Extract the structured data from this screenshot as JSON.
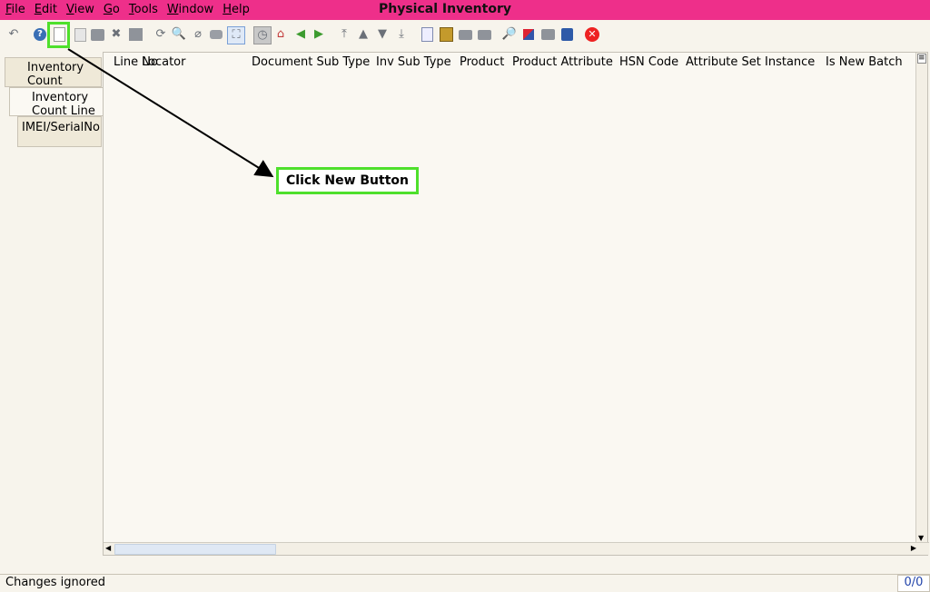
{
  "window": {
    "title": "Physical Inventory"
  },
  "menu": [
    {
      "pre": "",
      "u": "F",
      "post": "ile"
    },
    {
      "pre": "",
      "u": "E",
      "post": "dit"
    },
    {
      "pre": "",
      "u": "V",
      "post": "iew"
    },
    {
      "pre": "",
      "u": "G",
      "post": "o"
    },
    {
      "pre": "",
      "u": "T",
      "post": "ools"
    },
    {
      "pre": "",
      "u": "W",
      "post": "indow"
    },
    {
      "pre": "",
      "u": "H",
      "post": "elp"
    }
  ],
  "toolbar": {
    "icons": [
      "undo-icon",
      "help-icon",
      "new-record-icon",
      "copy-record-icon",
      "delete-icon",
      "delete-selection-icon",
      "save-icon",
      "refresh-icon",
      "find-icon",
      "attachment-icon",
      "chat-icon",
      "toggle-grid-icon",
      "history-icon",
      "home-icon",
      "back-icon",
      "forward-icon",
      "first-record-icon",
      "previous-record-icon",
      "next-record-icon",
      "last-record-icon",
      "report-icon",
      "archive-icon",
      "print-icon",
      "print-preview-icon",
      "zoom-across-icon",
      "active-workflows-icon",
      "requests-icon",
      "product-info-icon",
      "exit-icon"
    ]
  },
  "tabs": [
    {
      "label_1": "Inventory",
      "label_2": "Count",
      "active": false
    },
    {
      "label_1": "Inventory",
      "label_2": "Count Line",
      "active": true
    },
    {
      "label_1": "IMEI/SerialNo",
      "label_2": "",
      "active": false
    }
  ],
  "grid": {
    "columns": [
      "Line No",
      "Locator",
      "Document Sub Type",
      "Inv Sub Type",
      "Product",
      "Product Attribute",
      "HSN Code",
      "Attribute Set Instance",
      "Is New Batch"
    ]
  },
  "annotation": {
    "label": "Click New Button"
  },
  "status": {
    "message": "Changes ignored",
    "record_count": "0/0"
  },
  "colors": {
    "title_bar": "#ee2f8a",
    "highlight": "#4ee02c"
  }
}
